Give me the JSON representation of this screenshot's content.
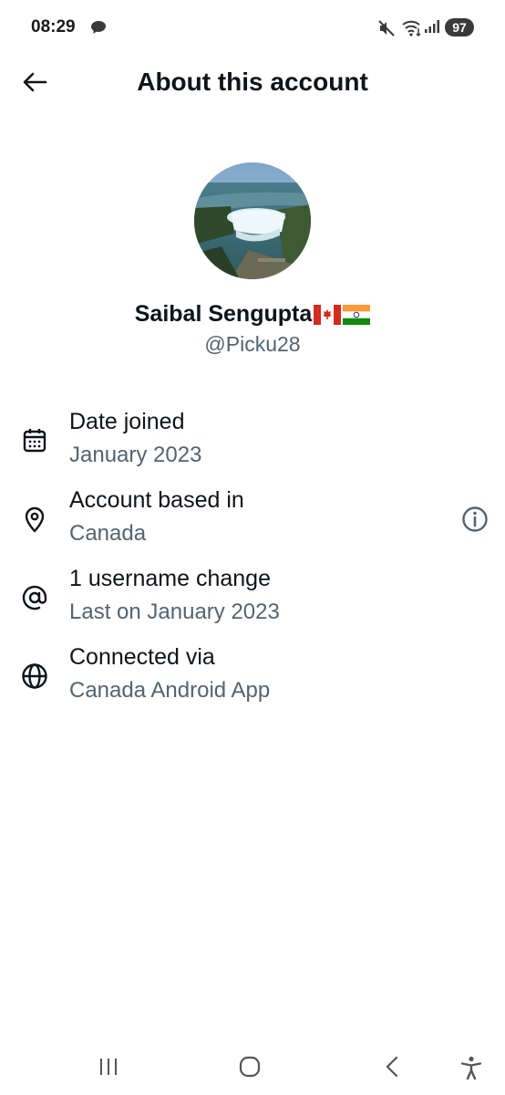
{
  "status_bar": {
    "time": "08:29",
    "battery": "97",
    "icons": [
      "chat-bubble-icon",
      "mute-icon",
      "wifi-icon",
      "signal-icon"
    ]
  },
  "header": {
    "title": "About this account",
    "back_icon": "arrow-left-icon"
  },
  "profile": {
    "name": "Saibal Sengupta",
    "flags": [
      "canada-flag",
      "india-flag"
    ],
    "handle": "@Picku28",
    "avatar": "niagara-falls-photo"
  },
  "details": [
    {
      "icon": "calendar-icon",
      "title": "Date joined",
      "value": "January 2023"
    },
    {
      "icon": "location-pin-icon",
      "title": "Account based in",
      "value": "Canada",
      "action_icon": "info-icon"
    },
    {
      "icon": "at-sign-icon",
      "title": "1 username change",
      "value": "Last on January 2023"
    },
    {
      "icon": "globe-icon",
      "title": "Connected via",
      "value": "Canada Android App"
    }
  ],
  "nav_bar": {
    "items": [
      "recent-apps-icon",
      "home-icon",
      "back-icon",
      "accessibility-icon"
    ]
  },
  "colors": {
    "primary_text": "#0f1419",
    "secondary_text": "#536471",
    "background": "#ffffff"
  }
}
